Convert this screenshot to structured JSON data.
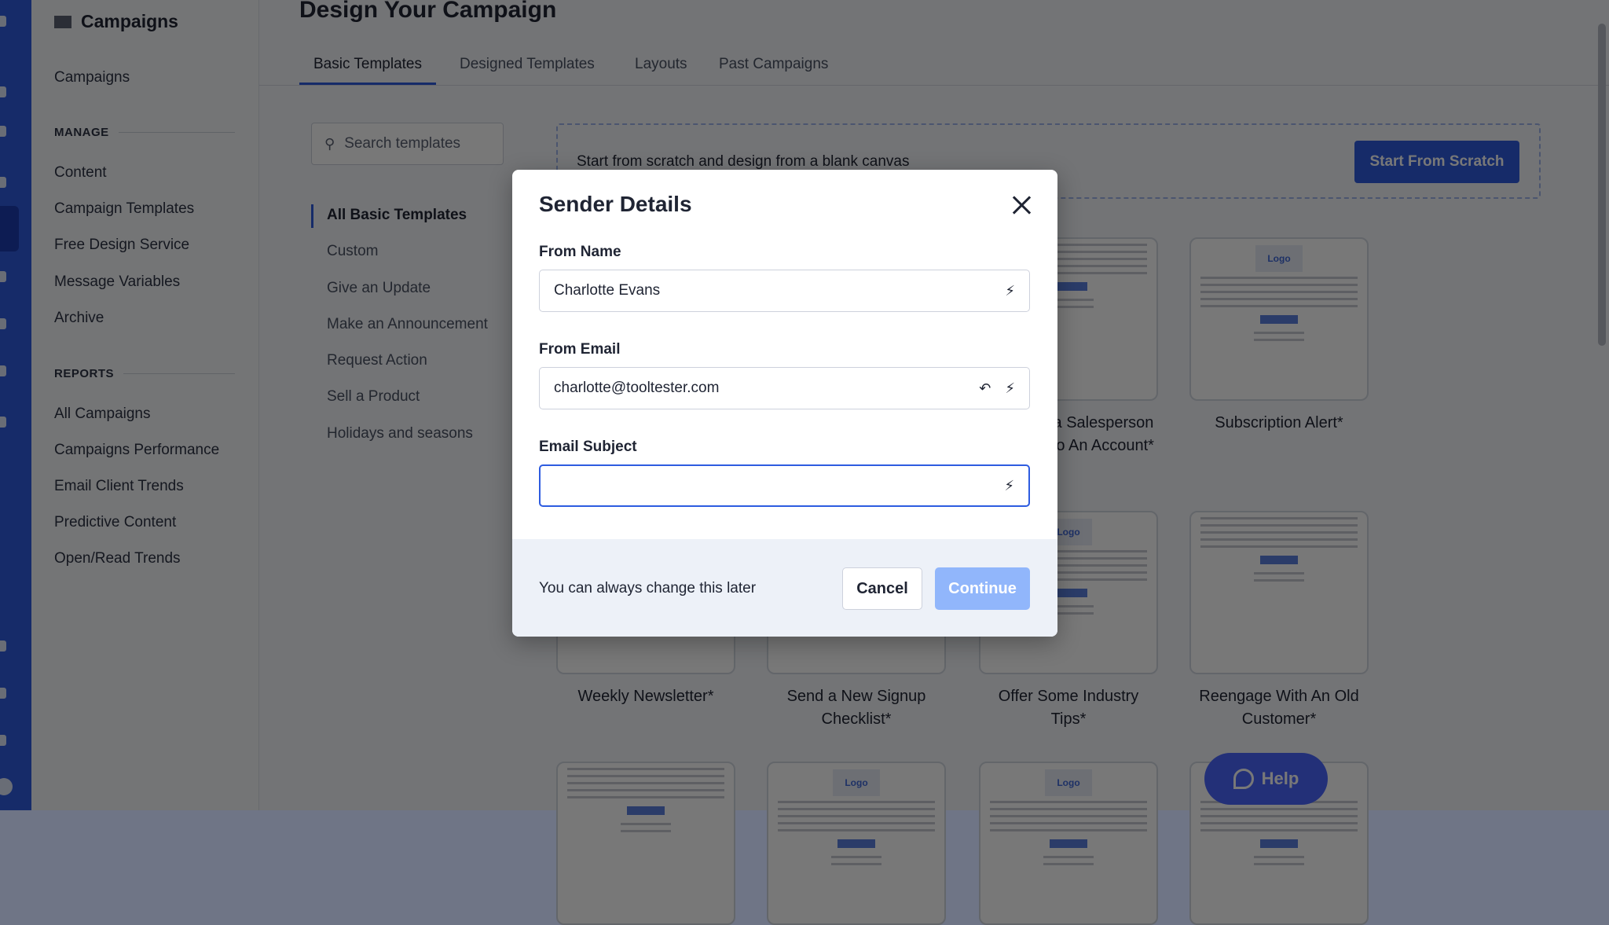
{
  "sidebar": {
    "title": "Campaigns",
    "top_item": "Campaigns",
    "manage_heading": "MANAGE",
    "manage": [
      "Content",
      "Campaign Templates",
      "Free Design Service",
      "Message Variables",
      "Archive"
    ],
    "reports_heading": "REPORTS",
    "reports": [
      "All Campaigns",
      "Campaigns Performance",
      "Email Client Trends",
      "Predictive Content",
      "Open/Read Trends"
    ]
  },
  "main": {
    "title": "Design Your Campaign",
    "tabs": [
      "Basic Templates",
      "Designed Templates",
      "Layouts",
      "Past Campaigns"
    ],
    "active_tab": "Basic Templates",
    "search_placeholder": "Search templates",
    "categories": [
      "All Basic Templates",
      "Custom",
      "Give an Update",
      "Make an Announcement",
      "Request Action",
      "Sell a Product",
      "Holidays and seasons"
    ],
    "scratch_text": "Start from scratch and design from a blank canvas",
    "scratch_button": "Start From Scratch",
    "cards_row1": [
      "",
      "",
      "Introduce a Salesperson Assigned to An Account*",
      "Subscription Alert*"
    ],
    "cards_row2": [
      "Weekly Newsletter*",
      "Send a New Signup Checklist*",
      "Offer Some Industry Tips*",
      "Reengage With An Old Customer*"
    ],
    "logo_placeholder": "Logo"
  },
  "help_button": "Help",
  "modal": {
    "title": "Sender Details",
    "from_name_label": "From Name",
    "from_name_value": "Charlotte Evans",
    "from_email_label": "From Email",
    "from_email_value": "charlotte@tooltester.com",
    "subject_label": "Email Subject",
    "subject_value": "",
    "footer_text": "You can always change this later",
    "cancel": "Cancel",
    "continue": "Continue"
  },
  "colors": {
    "accent": "#2e5ce0",
    "continue_disabled": "#91b6fb",
    "help": "#2138c9"
  }
}
